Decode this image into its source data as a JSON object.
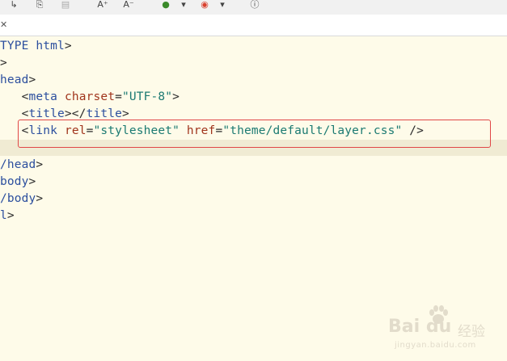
{
  "toolbar": {
    "items": [
      {
        "name": "step-into-icon",
        "glyph": "↳"
      },
      {
        "name": "save-icon",
        "glyph": "⎘"
      },
      {
        "name": "document-icon",
        "glyph": "▤"
      },
      {
        "name": "increase-font-icon",
        "glyph": "A⁺"
      },
      {
        "name": "decrease-font-icon",
        "glyph": "A⁻"
      },
      {
        "name": "run-icon",
        "glyph": "●"
      },
      {
        "name": "dropdown-arrow-icon",
        "glyph": "▾"
      },
      {
        "name": "chrome-icon",
        "glyph": "◉"
      },
      {
        "name": "dropdown-arrow-icon-2",
        "glyph": "▾"
      },
      {
        "name": "info-icon",
        "glyph": "ⓘ"
      }
    ]
  },
  "tab": {
    "close_glyph": "✕"
  },
  "code": {
    "lines": [
      {
        "tokens": [
          {
            "t": "tag",
            "v": "TYPE html"
          },
          {
            "t": "bracket",
            "v": ">"
          }
        ]
      },
      {
        "tokens": [
          {
            "t": "bracket",
            "v": ">"
          }
        ]
      },
      {
        "tokens": [
          {
            "t": "tag",
            "v": "head"
          },
          {
            "t": "bracket",
            "v": ">"
          }
        ]
      },
      {
        "indent": 3,
        "tokens": [
          {
            "t": "bracket",
            "v": "<"
          },
          {
            "t": "tag",
            "v": "meta"
          },
          {
            "t": "plain",
            "v": " "
          },
          {
            "t": "attr",
            "v": "charset"
          },
          {
            "t": "eq",
            "v": "="
          },
          {
            "t": "val",
            "v": "\"UTF-8\""
          },
          {
            "t": "bracket",
            "v": ">"
          }
        ]
      },
      {
        "indent": 3,
        "tokens": [
          {
            "t": "bracket",
            "v": "<"
          },
          {
            "t": "tag",
            "v": "title"
          },
          {
            "t": "bracket",
            "v": "></"
          },
          {
            "t": "tag",
            "v": "title"
          },
          {
            "t": "bracket",
            "v": ">"
          }
        ]
      },
      {
        "indent": 3,
        "tokens": [
          {
            "t": "bracket",
            "v": "<"
          },
          {
            "t": "tag",
            "v": "link"
          },
          {
            "t": "plain",
            "v": " "
          },
          {
            "t": "attr",
            "v": "rel"
          },
          {
            "t": "eq",
            "v": "="
          },
          {
            "t": "val",
            "v": "\"stylesheet\""
          },
          {
            "t": "plain",
            "v": " "
          },
          {
            "t": "attr",
            "v": "href"
          },
          {
            "t": "eq",
            "v": "="
          },
          {
            "t": "val",
            "v": "\"theme/default/layer.css\""
          },
          {
            "t": "plain",
            "v": " "
          },
          {
            "t": "bracket",
            "v": "/>"
          }
        ]
      },
      {
        "tokens": []
      },
      {
        "tokens": [
          {
            "t": "tag",
            "v": "/head"
          },
          {
            "t": "bracket",
            "v": ">"
          }
        ]
      },
      {
        "tokens": [
          {
            "t": "tag",
            "v": "body"
          },
          {
            "t": "bracket",
            "v": ">"
          }
        ]
      },
      {
        "tokens": [
          {
            "t": "tag",
            "v": "/body"
          },
          {
            "t": "bracket",
            "v": ">"
          }
        ]
      },
      {
        "tokens": [
          {
            "t": "tag",
            "v": "l"
          },
          {
            "t": "bracket",
            "v": ">"
          }
        ]
      }
    ]
  },
  "watermark": {
    "logo": "Bai du",
    "text": "经验",
    "url": "jingyan.baidu.com"
  }
}
